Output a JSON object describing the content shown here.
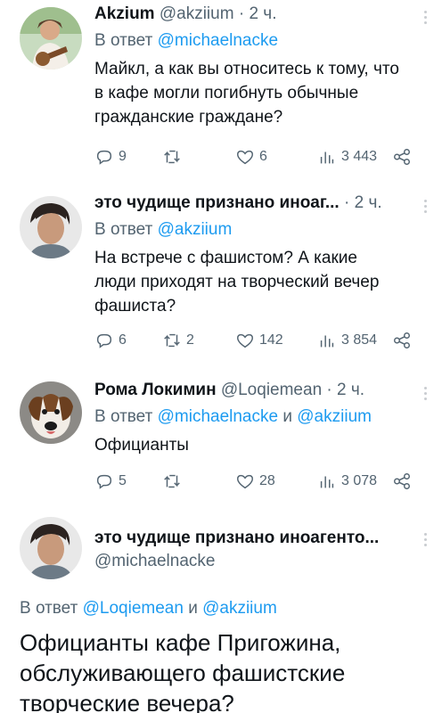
{
  "tweets": [
    {
      "name": "Akzium",
      "handle": "@akziium",
      "dot": "·",
      "time": "2 ч.",
      "reply_prefix": "В ответ",
      "reply_to": "@michaelnacke",
      "reply_and": "",
      "reply_to2": "",
      "text": "Майкл, а как вы относитесь к тому, что в кафе могли погибнуть обычные гражданские граждане?",
      "replies": "9",
      "retweets": "",
      "likes": "6",
      "views": "3 443"
    },
    {
      "name": "это чудище признано иноаг...",
      "handle": "",
      "dot": "·",
      "time": "2 ч.",
      "reply_prefix": "В ответ",
      "reply_to": "@akziium",
      "reply_and": "",
      "reply_to2": "",
      "text": "На встрече с фашистом? А какие люди приходят на творческий вечер фашиста?",
      "replies": "6",
      "retweets": "2",
      "likes": "142",
      "views": "3 854"
    },
    {
      "name": "Рома Локимин",
      "handle": "@Loqiemean",
      "dot": "·",
      "time": "2 ч.",
      "reply_prefix": "В ответ",
      "reply_to": "@michaelnacke",
      "reply_and": "и",
      "reply_to2": "@akziium",
      "text": "Официанты",
      "replies": "5",
      "retweets": "",
      "likes": "28",
      "views": "3 078"
    }
  ],
  "focus": {
    "name": "это чудище признано иноагенто...",
    "handle": "@michaelnacke",
    "reply_prefix": "В ответ",
    "reply_to": "@Loqiemean",
    "reply_and": "и",
    "reply_to2": "@akziium",
    "text": "Официанты кафе Пригожина, обслуживающего фашистские творческие вечера?"
  },
  "colors": {
    "link": "#1d9bf0",
    "secondary_text": "#536471",
    "primary_text": "#0f1419"
  },
  "icons": [
    "reply-icon",
    "retweet-icon",
    "like-icon",
    "views-icon",
    "share-icon",
    "more-icon"
  ]
}
